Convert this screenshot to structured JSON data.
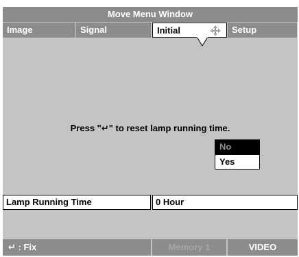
{
  "window": {
    "title": "Move Menu Window"
  },
  "tabs": [
    {
      "label": "Image"
    },
    {
      "label": "Signal"
    },
    {
      "label": "Initial"
    },
    {
      "label": "Setup"
    }
  ],
  "active_tab_index": 2,
  "dialog": {
    "message": "Press \"↵\" to reset lamp running time.",
    "options": [
      {
        "label": "No"
      },
      {
        "label": "Yes"
      }
    ]
  },
  "lamp_row": {
    "label": "Lamp Running Time",
    "value": "0 Hour"
  },
  "footer": {
    "fix_label": "↵ : Fix",
    "memory_label": "Memory 1",
    "mode_label": "VIDEO"
  },
  "icons": {
    "move": "move-arrows-icon",
    "enter": "enter-icon"
  }
}
